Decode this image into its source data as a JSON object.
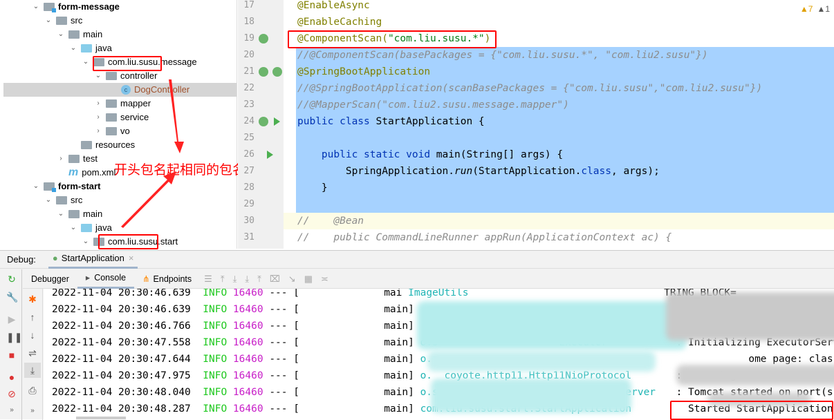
{
  "tree": [
    {
      "label": "form-message",
      "bold": true,
      "chev": "v",
      "type": "module"
    },
    {
      "label": "src",
      "chev": "v",
      "type": "folder"
    },
    {
      "label": "main",
      "chev": "v",
      "type": "folder"
    },
    {
      "label": "java",
      "chev": "v",
      "type": "src"
    },
    {
      "label": "com.liu.susu.message",
      "chev": "v",
      "type": "pkg"
    },
    {
      "label": "controller",
      "chev": "v",
      "type": "pkg"
    },
    {
      "label": "DogController",
      "chev": "",
      "type": "class",
      "selected": true
    },
    {
      "label": "mapper",
      "chev": ">",
      "type": "pkg"
    },
    {
      "label": "service",
      "chev": ">",
      "type": "pkg"
    },
    {
      "label": "vo",
      "chev": ">",
      "type": "pkg"
    },
    {
      "label": "resources",
      "chev": "",
      "type": "res"
    },
    {
      "label": "test",
      "chev": ">",
      "type": "folder"
    },
    {
      "label": "pom.xml",
      "chev": "",
      "type": "maven"
    },
    {
      "label": "form-start",
      "bold": true,
      "chev": "v",
      "type": "module"
    },
    {
      "label": "src",
      "chev": "v",
      "type": "folder"
    },
    {
      "label": "main",
      "chev": "v",
      "type": "folder"
    },
    {
      "label": "java",
      "chev": "v",
      "type": "src"
    },
    {
      "label": "com.liu.susu.start",
      "chev": "v",
      "type": "pkg"
    }
  ],
  "annotation_text": "开头包名起相同的包名",
  "editor": {
    "warnings": "▲7",
    "weak_warnings": "▲1",
    "lines": [
      {
        "n": "17",
        "html": "<span class='ann'>@EnableAsync</span>"
      },
      {
        "n": "18",
        "html": "<span class='ann'>@EnableCaching</span>"
      },
      {
        "n": "19",
        "html": "<span class='ann'>@ComponentScan(</span><span class='str'>\"com.liu.susu.*\"</span><span class='ann'>)</span>"
      },
      {
        "n": "20",
        "html": "<span class='cm'>//@ComponentScan(basePackages = {\"com.liu.susu.*\", \"com.liu2.susu\"})</span>"
      },
      {
        "n": "21",
        "html": "<span class='ann'>@SpringBootApplication</span>"
      },
      {
        "n": "22",
        "html": "<span class='cm'>//@SpringBootApplication(scanBasePackages = {\"com.liu.susu\",\"com.liu2.susu\"})</span>"
      },
      {
        "n": "23",
        "html": "<span class='cm'>//@MapperScan(\"com.liu2.susu.message.mapper\")</span>"
      },
      {
        "n": "24",
        "html": "<span class='kw'>public class</span> StartApplication {"
      },
      {
        "n": "25",
        "html": ""
      },
      {
        "n": "26",
        "html": "    <span class='kw'>public static void</span> main(String[] args) {"
      },
      {
        "n": "27",
        "html": "        SpringApplication.<span class='it'>run</span>(StartApplication.<span class='kw'>class</span>, args);"
      },
      {
        "n": "28",
        "html": "    }"
      },
      {
        "n": "29",
        "html": ""
      },
      {
        "n": "30",
        "html": "<span class='cm'>//    @Bean</span>"
      },
      {
        "n": "31",
        "html": "<span class='cm'>//    public CommandLineRunner appRun(ApplicationContext ac) {</span>"
      }
    ]
  },
  "debug": {
    "label": "Debug:",
    "tab": "StartApplication",
    "tabs": [
      "Debugger",
      "Console",
      "Endpoints"
    ],
    "console": [
      {
        "ts": "2022-11-04 20:30:46.639",
        "lvl": "INFO",
        "pid": "16460",
        "sep": "--- [",
        "thr": "mai",
        "logger": "ImageUtils",
        "msg": "TRING_BLOCK="
      },
      {
        "ts": "2022-11-04 20:30:46.639",
        "lvl": "INFO",
        "pid": "16460",
        "sep": "--- [",
        "thr": "main]",
        "logger": "",
        "msg": ""
      },
      {
        "ts": "2022-11-04 20:30:46.766",
        "lvl": "INFO",
        "pid": "16460",
        "sep": "--- [",
        "thr": "main]",
        "logger": "",
        "msg": ""
      },
      {
        "ts": "2022-11-04 20:30:47.558",
        "lvl": "INFO",
        "pid": "16460",
        "sep": "--- [",
        "thr": "main]",
        "logger": "o.s                    Executor",
        "msg": ": Initializing ExecutorServ"
      },
      {
        "ts": "2022-11-04 20:30:47.644",
        "lvl": "INFO",
        "pid": "16460",
        "sep": "--- [",
        "thr": "main]",
        "logger": "o.s",
        "msg": "            ome page: clas"
      },
      {
        "ts": "2022-11-04 20:30:47.975",
        "lvl": "INFO",
        "pid": "16460",
        "sep": "--- [",
        "thr": "main]",
        "logger": "o.  coyote.http11.Http11NioProtocol",
        "msg": ": Starting P          er"
      },
      {
        "ts": "2022-11-04 20:30:48.040",
        "lvl": "INFO",
        "pid": "16460",
        "sep": "--- [",
        "thr": "main]",
        "logger": "o.s.b.w.embedded.tomcat.TomcatWebServer",
        "msg": ": Tomcat started on port(s)"
      },
      {
        "ts": "2022-11-04 20:30:48.287",
        "lvl": "INFO",
        "pid": "16460",
        "sep": "--- [",
        "thr": "main]",
        "logger": "com.liu.susu.start.StartApplication",
        "msg": "  Started StartApplication"
      }
    ]
  },
  "colors": {
    "highlight": "#ff0000",
    "selection": "#a6d2ff",
    "info": "#1ec81e",
    "pid": "#c81ec8",
    "logger": "#1eb4b4"
  }
}
